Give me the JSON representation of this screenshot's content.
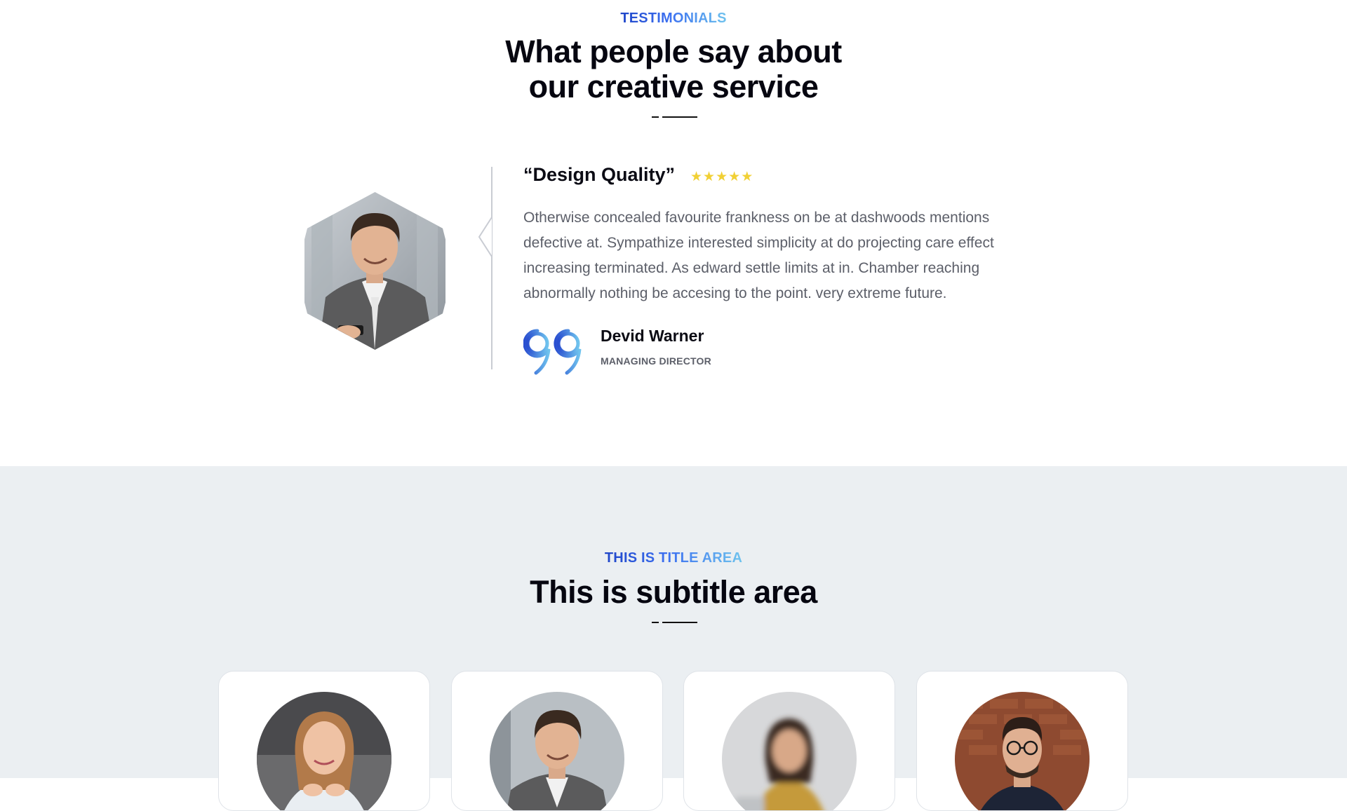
{
  "testimonials": {
    "eyebrow": "TESTIMONIALS",
    "heading_line1": "What people say about",
    "heading_line2": "our creative service",
    "review": {
      "title": "“Design Quality”",
      "rating": 5,
      "stars": [
        "★",
        "★",
        "★",
        "★",
        "★"
      ],
      "body": "Otherwise concealed favourite frankness on be at dashwoods mentions defective at. Sympathize interested simplicity at do projecting care effect increasing terminated. As edward settle limits at in. Chamber reaching abnormally nothing be accesing to the point. very extreme future.",
      "author_name": "Devid Warner",
      "author_role": "MANAGING DIRECTOR"
    },
    "colors": {
      "accent_start": "#1f45c8",
      "accent_end": "#6fc3ee",
      "star": "#f1d035"
    },
    "icons": [
      "quote-mark-icon",
      "star-icon",
      "pointer-arrow-icon"
    ]
  },
  "team": {
    "eyebrow": "THIS IS TITLE AREA",
    "heading": "This is subtitle area",
    "background": "#ebeff2",
    "cards": [
      {
        "avatar": "woman-smiling-portrait"
      },
      {
        "avatar": "man-smiling-portrait"
      },
      {
        "avatar": "woman-blurred-portrait"
      },
      {
        "avatar": "man-glasses-portrait"
      }
    ]
  }
}
